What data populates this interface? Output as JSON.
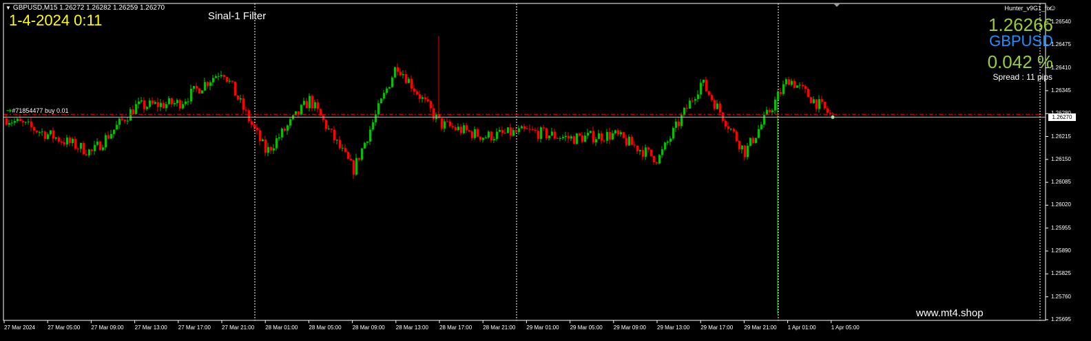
{
  "header": {
    "symbol_line": "GBPUSD,M15  1.26272 1.26282 1.26259 1.26270",
    "datetime": "1-4-2024 0:11",
    "filter_label": "Sinal-1 Filter"
  },
  "indicator": {
    "ea_name": "Hunter_v9G1_fix",
    "price": "1.26266",
    "symbol": "GBPUSD",
    "change": "0.042 %",
    "spread": "Spread : 11 pips"
  },
  "order": {
    "label": "#71854477 buy 0.01",
    "open_price": 1.26278
  },
  "current_price": "1.26270",
  "watermark": "www.mt4.shop",
  "price_axis": {
    "min": 1.25695,
    "max": 1.2654,
    "ticks": [
      "1.26540",
      "1.26475",
      "1.26410",
      "1.26345",
      "1.26280",
      "1.26215",
      "1.26150",
      "1.26085",
      "1.26020",
      "1.25955",
      "1.25890",
      "1.25825",
      "1.25760",
      "1.25695"
    ]
  },
  "time_axis": {
    "ticks": [
      "27 Mar 2024",
      "27 Mar 05:00",
      "27 Mar 09:00",
      "27 Mar 13:00",
      "27 Mar 17:00",
      "27 Mar 21:00",
      "28 Mar 01:00",
      "28 Mar 05:00",
      "28 Mar 09:00",
      "28 Mar 13:00",
      "28 Mar 17:00",
      "28 Mar 21:00",
      "29 Mar 01:00",
      "29 Mar 05:00",
      "29 Mar 09:00",
      "29 Mar 13:00",
      "29 Mar 17:00",
      "29 Mar 21:00",
      "1 Apr 01:00",
      "1 Apr 05:00"
    ]
  },
  "colors": {
    "background": "#000000",
    "bull": "#00c000",
    "bear": "#ff0000",
    "grid_line": "#ffffff",
    "order_line": "#ff0000",
    "yellow_text": "#ffff00",
    "green_text": "#9ACD32",
    "blue_text": "#1E90FF"
  },
  "chart_data": {
    "type": "candlestick",
    "symbol": "GBPUSD",
    "timeframe": "M15",
    "day_separators": [
      "28 Mar 2024",
      "29 Mar 2024",
      "1 Apr 2024"
    ],
    "key_levels": [
      {
        "time": "27 Mar 2024",
        "price": 1.26268
      },
      {
        "time": "27 Mar 05:00",
        "price": 1.2622
      },
      {
        "time": "27 Mar 09:00",
        "price": 1.2617
      },
      {
        "time": "27 Mar 13:00",
        "price": 1.263
      },
      {
        "time": "27 Mar 17:00",
        "price": 1.2631
      },
      {
        "time": "27 Mar 21:00",
        "price": 1.26405
      },
      {
        "time": "28 Mar 01:00",
        "price": 1.2617
      },
      {
        "time": "28 Mar 05:00",
        "price": 1.2632
      },
      {
        "time": "28 Mar 09:00",
        "price": 1.2612
      },
      {
        "time": "28 Mar 13:00",
        "price": 1.2642
      },
      {
        "time": "28 Mar 17:00",
        "price": 1.2625
      },
      {
        "time": "28 Mar 21:00",
        "price": 1.26215
      },
      {
        "time": "29 Mar 01:00",
        "price": 1.2623
      },
      {
        "time": "29 Mar 05:00",
        "price": 1.2621
      },
      {
        "time": "29 Mar 09:00",
        "price": 1.2622
      },
      {
        "time": "29 Mar 13:00",
        "price": 1.2615
      },
      {
        "time": "29 Mar 17:00",
        "price": 1.2637
      },
      {
        "time": "29 Mar 21:00",
        "price": 1.2617
      },
      {
        "time": "1 Apr 01:00",
        "price": 1.2638
      },
      {
        "time": "1 Apr 05:00",
        "price": 1.2627
      }
    ],
    "session_low": 1.2571,
    "session_high": 1.265
  }
}
